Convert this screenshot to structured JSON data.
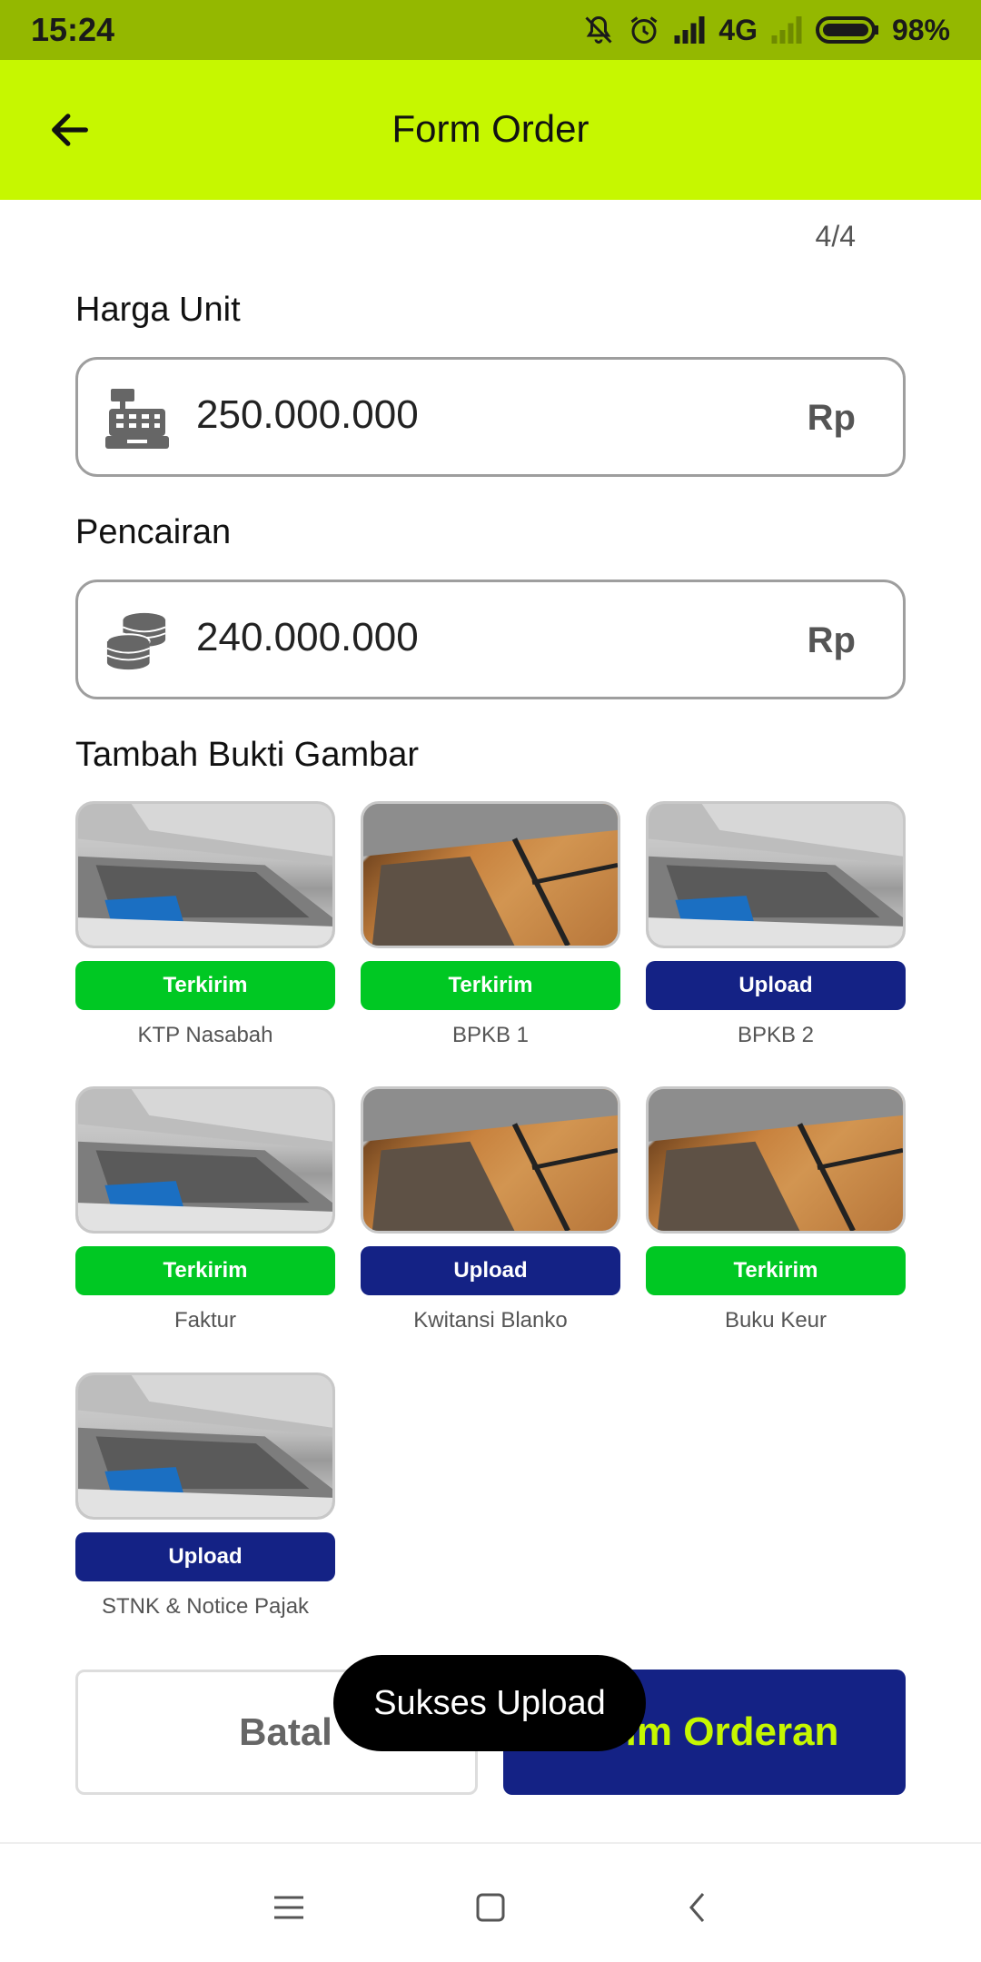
{
  "status_bar": {
    "time": "15:24",
    "network": "4G",
    "battery": "98%",
    "icons": [
      "mute-icon",
      "alarm-icon",
      "signal-icon",
      "signal-weak-icon",
      "battery-icon"
    ]
  },
  "app_bar": {
    "title": "Form Order",
    "back_icon": "arrow-left-icon"
  },
  "step": "4/4",
  "harga_unit": {
    "label": "Harga Unit",
    "value": "250.000.000",
    "suffix": "Rp",
    "icon": "cash-register-icon"
  },
  "pencairan": {
    "label": "Pencairan",
    "value": "240.000.000",
    "suffix": "Rp",
    "icon": "coins-icon"
  },
  "bukti": {
    "title": "Tambah Bukti Gambar",
    "items": [
      {
        "label": "KTP Nasabah",
        "status": "Terkirim",
        "photo": "laptop"
      },
      {
        "label": "BPKB 1",
        "status": "Terkirim",
        "photo": "floor"
      },
      {
        "label": "BPKB 2",
        "status": "Upload",
        "photo": "laptop"
      },
      {
        "label": "Faktur",
        "status": "Terkirim",
        "photo": "laptop"
      },
      {
        "label": "Kwitansi Blanko",
        "status": "Upload",
        "photo": "floor"
      },
      {
        "label": "Buku Keur",
        "status": "Terkirim",
        "photo": "floor"
      },
      {
        "label": "STNK & Notice Pajak",
        "status": "Upload",
        "photo": "laptop"
      }
    ]
  },
  "actions": {
    "cancel": "Batal",
    "submit": "Kirim Orderan"
  },
  "toast": "Sukses Upload",
  "colors": {
    "accent": "#c6f700",
    "status_bar": "#94b800",
    "sent": "#00c823",
    "upload": "#142285"
  },
  "nav": {
    "icons": [
      "menu-icon",
      "home-square-icon",
      "back-chevron-icon"
    ]
  }
}
